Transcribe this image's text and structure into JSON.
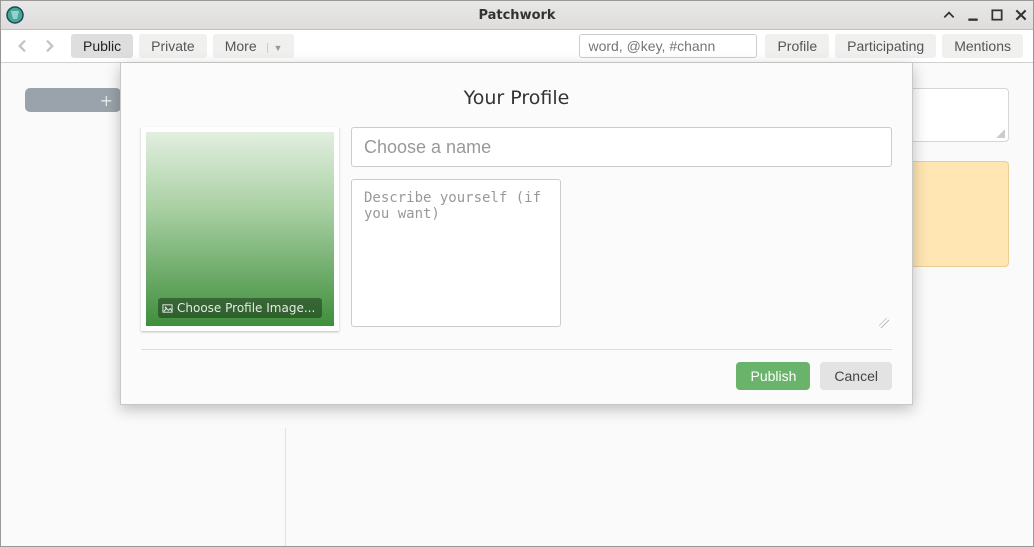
{
  "window": {
    "title": "Patchwork"
  },
  "toolbar": {
    "tabs": {
      "public": "Public",
      "private": "Private",
      "more": "More"
    },
    "search_placeholder": "word, @key, #chann",
    "right": {
      "profile": "Profile",
      "participating": "Participating",
      "mentions": "Mentions"
    }
  },
  "sidebar": {
    "add_label": "+"
  },
  "modal": {
    "title": "Your Profile",
    "choose_image": "Choose Profile Image...",
    "name_placeholder": "Choose a name",
    "desc_placeholder": "Describe yourself (if you want)",
    "publish": "Publish",
    "cancel": "Cancel"
  }
}
